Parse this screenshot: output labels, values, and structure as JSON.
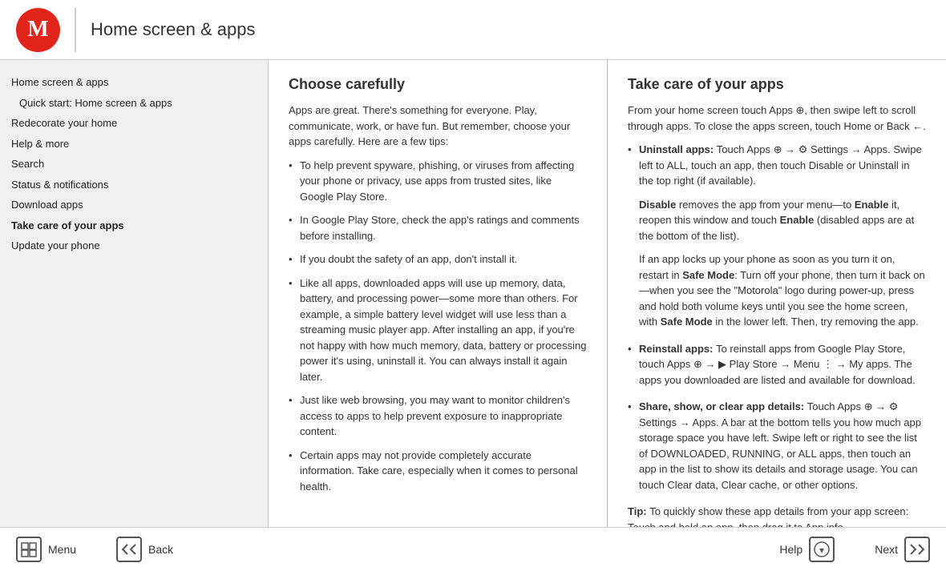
{
  "header": {
    "title": "Home screen & apps"
  },
  "sidebar": {
    "items": [
      {
        "id": "home-screen-apps",
        "label": "Home screen & apps",
        "indent": false,
        "active": false
      },
      {
        "id": "quick-start",
        "label": "Quick start: Home screen & apps",
        "indent": true,
        "active": false
      },
      {
        "id": "redecorate",
        "label": "Redecorate your home",
        "indent": false,
        "active": false
      },
      {
        "id": "help-more",
        "label": "Help & more",
        "indent": false,
        "active": false
      },
      {
        "id": "search",
        "label": "Search",
        "indent": false,
        "active": false
      },
      {
        "id": "status-notifications",
        "label": "Status & notifications",
        "indent": false,
        "active": false
      },
      {
        "id": "download-apps",
        "label": "Download apps",
        "indent": false,
        "active": false
      },
      {
        "id": "take-care-apps",
        "label": "Take care of your apps",
        "indent": false,
        "active": true
      },
      {
        "id": "update-phone",
        "label": "Update your phone",
        "indent": false,
        "active": false
      }
    ]
  },
  "left_panel": {
    "title": "Choose carefully",
    "intro": "Apps are great. There's something for everyone. Play, communicate, work, or have fun. But remember, choose your apps carefully. Here are a few tips:",
    "bullets": [
      "To help prevent spyware, phishing, or viruses from affecting your phone or privacy, use apps from trusted sites, like Google Play Store.",
      "In Google Play Store, check the app's ratings and comments before installing.",
      "If you doubt the safety of an app, don't install it.",
      "Like all apps, downloaded apps will use up memory, data, battery, and processing power—some more than others. For example, a simple battery level widget will use less than a streaming music player app. After installing an app, if you're not happy with how much memory, data, battery or processing power it's using, uninstall it. You can always install it again later.",
      "Just like web browsing, you may want to monitor children's access to apps to help prevent exposure to inappropriate content.",
      "Certain apps may not provide completely accurate information. Take care, especially when it comes to personal health."
    ]
  },
  "right_panel": {
    "title": "Take care of your apps",
    "intro": "From your home screen touch Apps ⊕, then swipe left to scroll through apps. To close the apps screen, touch Home or Back ←.",
    "sections": [
      {
        "id": "uninstall",
        "title": "Uninstall apps:",
        "body": "Touch Apps ⊕ → ⚙ Settings → Apps. Swipe left to ALL, touch an app, then touch Disable or Uninstall in the top right (if available).",
        "sub": "Disable removes the app from your menu—to Enable it, reopen this window and touch Enable (disabled apps are at the bottom of the list).",
        "sub2": "If an app locks up your phone as soon as you turn it on, restart in Safe Mode: Turn off your phone, then turn it back on—when you see the \"Motorola\" logo during power-up, press and hold both volume keys until you see the home screen, with Safe Mode in the lower left. Then, try removing the app."
      },
      {
        "id": "reinstall",
        "title": "Reinstall apps:",
        "body": "To reinstall apps from Google Play Store, touch Apps ⊕ → ▶ Play Store → Menu ⋮ → My apps. The apps you downloaded are listed and available for download."
      },
      {
        "id": "share",
        "title": "Share, show, or clear app details:",
        "body": "Touch Apps ⊕ → ⚙ Settings → Apps. A bar at the bottom tells you how much app storage space you have left. Swipe left or right to see the list of DOWNLOADED, RUNNING, or ALL apps, then touch an app in the list to show its details and storage usage. You can touch Clear data, Clear cache, or other options."
      },
      {
        "id": "tip",
        "title": "Tip:",
        "body": "To quickly show these app details from your app screen: Touch and hold an app, then drag it to App info."
      }
    ]
  },
  "footer": {
    "menu_label": "Menu",
    "back_label": "Back",
    "help_label": "Help",
    "next_label": "Next"
  }
}
